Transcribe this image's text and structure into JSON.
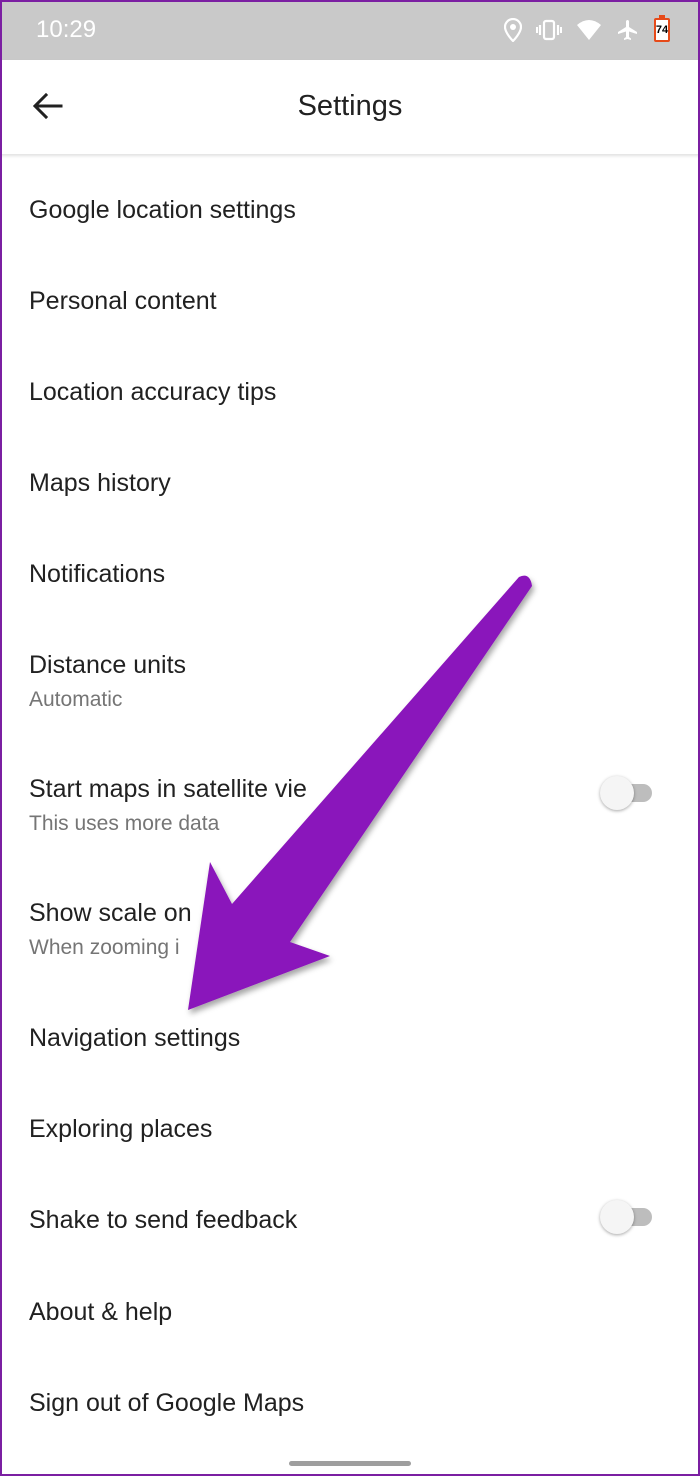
{
  "status_bar": {
    "time": "10:29",
    "battery_level": "74",
    "icons": [
      "location-icon",
      "vibrate-icon",
      "wifi-icon",
      "airplane-icon",
      "battery-icon"
    ]
  },
  "app_bar": {
    "title": "Settings",
    "back_icon": "arrow-back-icon"
  },
  "settings": {
    "google_location": "Google location settings",
    "personal_content": "Personal content",
    "location_accuracy": "Location accuracy tips",
    "maps_history": "Maps history",
    "notifications": "Notifications",
    "distance_units": {
      "title": "Distance units",
      "subtitle": "Automatic"
    },
    "satellite_view": {
      "title": "Start maps in satellite vie",
      "subtitle": "This uses more data",
      "enabled": false
    },
    "show_scale": {
      "title": "Show scale on",
      "subtitle": "When zooming i"
    },
    "navigation": "Navigation settings",
    "exploring_places": "Exploring places",
    "shake_feedback": {
      "title": "Shake to send feedback",
      "enabled": false
    },
    "about_help": "About & help",
    "sign_out": "Sign out of Google Maps"
  },
  "colors": {
    "annotation_arrow": "#8a12bb",
    "status_bar_bg": "#c9c9c9",
    "border": "#7b1fa2"
  }
}
